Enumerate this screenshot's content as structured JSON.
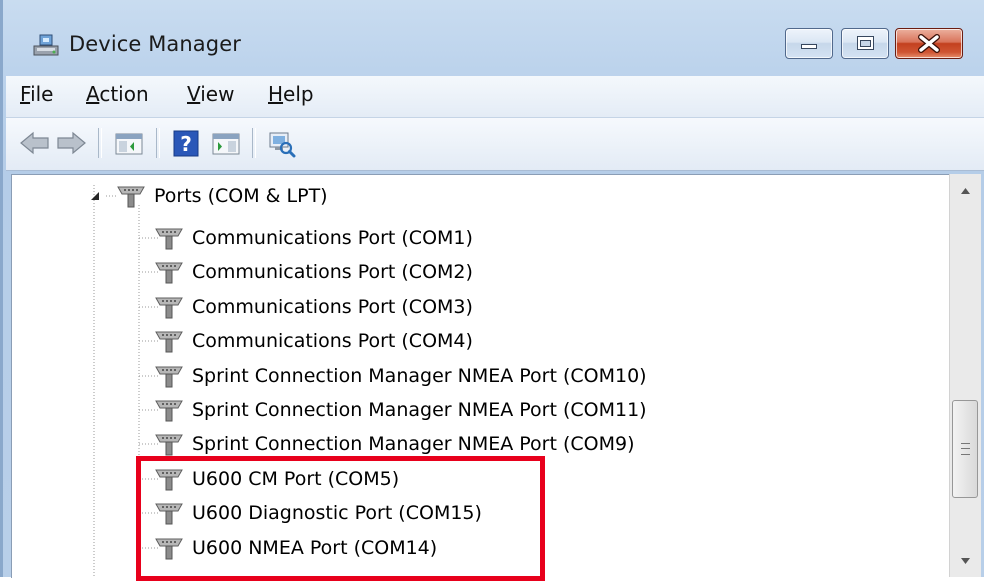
{
  "window": {
    "title": "Device Manager",
    "icons": [
      "device-manager-icon",
      "minimize-icon",
      "maximize-icon",
      "close-icon"
    ]
  },
  "menu": [
    {
      "accel": "F",
      "rest": "ile"
    },
    {
      "accel": "A",
      "rest": "ction"
    },
    {
      "accel": "V",
      "rest": "iew"
    },
    {
      "accel": "H",
      "rest": "elp"
    }
  ],
  "toolbar": {
    "icons": [
      "back-arrow-icon",
      "forward-arrow-icon",
      "show-hide-console-tree-icon",
      "help-icon",
      "properties-icon",
      "scan-hardware-icon"
    ]
  },
  "tree": {
    "category": {
      "label": "Ports (COM & LPT)",
      "expanded": true,
      "icon": "port-icon"
    },
    "items": [
      {
        "label": "Communications Port (COM1)"
      },
      {
        "label": "Communications Port (COM2)"
      },
      {
        "label": "Communications Port (COM3)"
      },
      {
        "label": "Communications Port (COM4)"
      },
      {
        "label": "Sprint Connection Manager NMEA Port (COM10)"
      },
      {
        "label": "Sprint Connection Manager NMEA Port (COM11)"
      },
      {
        "label": "Sprint Connection Manager NMEA Port (COM9)"
      },
      {
        "label": "U600 CM Port (COM5)"
      },
      {
        "label": "U600 Diagnostic Port (COM15)"
      },
      {
        "label": "U600 NMEA Port (COM14)"
      }
    ]
  },
  "annotation": {
    "color": "#e8001c",
    "shape": "rectangle"
  },
  "colors": {
    "titlebar": "#c9dcf0",
    "close_button": "#c3401f"
  }
}
